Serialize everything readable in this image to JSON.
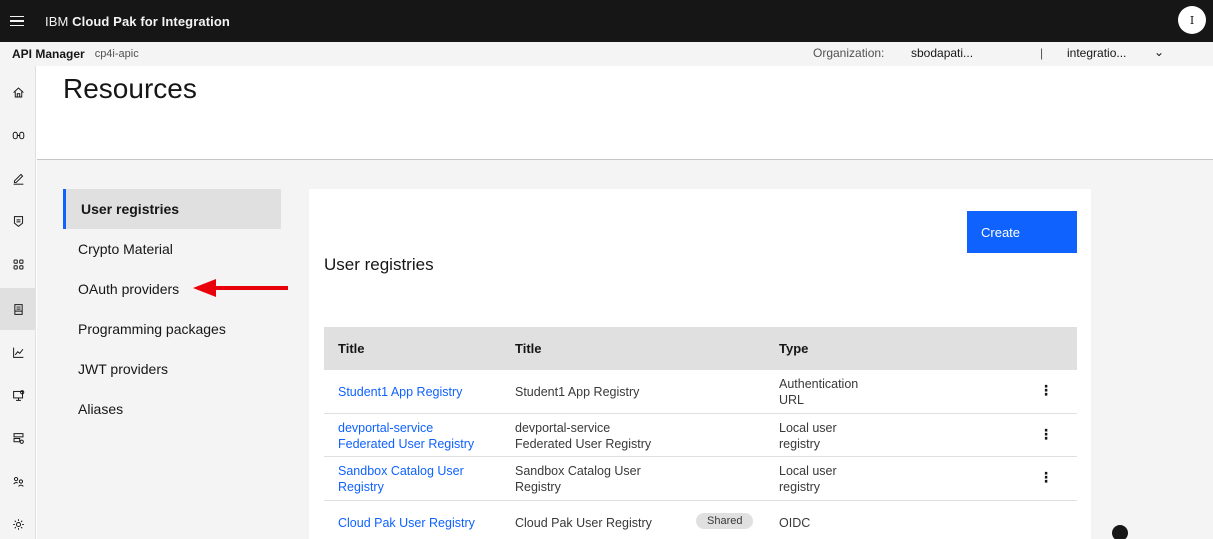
{
  "header": {
    "brand_prefix": "IBM",
    "brand_name": "Cloud Pak for Integration",
    "avatar_initial": "I"
  },
  "subheader": {
    "product": "API Manager",
    "instance": "cp4i-apic",
    "org_label": "Organization:",
    "org_value": "sbodapati...",
    "separator": "|",
    "catalog_value": "integratio...",
    "chevron": "⌄"
  },
  "rail": {
    "icons": [
      "home-icon",
      "apis-icon",
      "develop-icon",
      "manage-icon",
      "catalog-grid-icon",
      "resources-icon",
      "analytics-icon",
      "test-icon",
      "products-icon",
      "members-icon",
      "settings-icon"
    ],
    "active": "resources-icon"
  },
  "page": {
    "title": "Resources"
  },
  "sidenav": {
    "items": [
      {
        "label": "User registries"
      },
      {
        "label": "Crypto Material"
      },
      {
        "label": "OAuth providers"
      },
      {
        "label": "Programming packages"
      },
      {
        "label": "JWT providers"
      },
      {
        "label": "Aliases"
      }
    ],
    "active_index": 0
  },
  "card": {
    "title": "User registries",
    "create_label": "Create",
    "table": {
      "headers": [
        "Title",
        "Title",
        "Type"
      ],
      "rows": [
        {
          "link": "Student1 App Registry",
          "title": "Student1 App Registry",
          "type": "Authentication URL",
          "type_l1": "Authentication",
          "type_l2": "URL",
          "link_l1": "Student1 App Registry",
          "link_l2": "",
          "title_l1": "Student1 App Registry",
          "title_l2": ""
        },
        {
          "link": "devportal-service Federated User Registry",
          "title": "devportal-service Federated User Registry",
          "type": "Local user registry",
          "link_l1": "devportal-service",
          "link_l2": "Federated User Registry",
          "title_l1": "devportal-service",
          "title_l2": "Federated User Registry",
          "type_l1": "Local user",
          "type_l2": "registry"
        },
        {
          "link": "Sandbox Catalog User Registry",
          "title": "Sandbox Catalog User Registry",
          "type": "Local user registry",
          "link_l1": "Sandbox Catalog User",
          "link_l2": "Registry",
          "title_l1": "Sandbox Catalog User",
          "title_l2": "Registry",
          "type_l1": "Local user",
          "type_l2": "registry"
        },
        {
          "link": "Cloud Pak User Registry",
          "title": "Cloud Pak User Registry",
          "type": "OIDC",
          "tag": "Shared"
        }
      ],
      "kebab": "⋮"
    }
  },
  "colors": {
    "accent": "#0f62fe",
    "annotation_arrow": "#e8000b",
    "topbar": "#161616"
  }
}
